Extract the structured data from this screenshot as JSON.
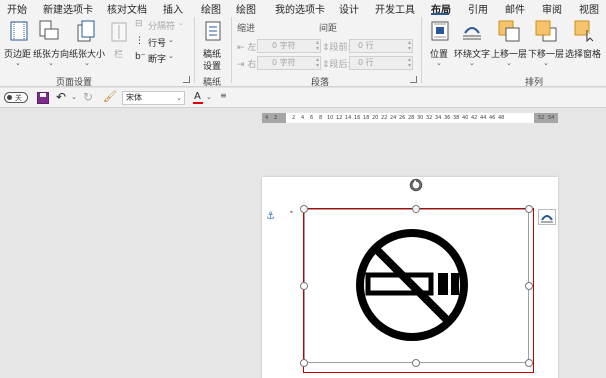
{
  "tabs": [
    "开始",
    "新建选项卡",
    "核对文档",
    "插入",
    "绘图",
    "绘图",
    "我的选项卡",
    "设计",
    "开发工具",
    "布局",
    "引用",
    "邮件",
    "审阅",
    "视图"
  ],
  "active_tab": "布局",
  "page_setup": {
    "margins": "页边距",
    "orientation": "纸张方向",
    "size": "纸张大小",
    "columns": "栏",
    "breaks": "分隔符",
    "line_numbers": "行号",
    "hyphenation": "断字",
    "group_title": "页面设置"
  },
  "draft": {
    "button_line1": "稿纸",
    "button_line2": "设置",
    "group_title": "稿纸"
  },
  "paragraph": {
    "indent_title": "缩进",
    "spacing_title": "间距",
    "left_label": "左:",
    "right_label": "右:",
    "before_label": "段前:",
    "after_label": "段后:",
    "indent_left_value": "0 字符",
    "indent_right_value": "0 字符",
    "spacing_before_value": "0 行",
    "spacing_after_value": "0 行",
    "group_title": "段落"
  },
  "arrange": {
    "position": "位置",
    "wrap_text": "环绕文字",
    "bring_forward": "上移一层",
    "send_backward": "下移一层",
    "selection_pane": "选择窗格",
    "group_title": "排列"
  },
  "qat": {
    "autosave_toggle": "关",
    "font_name": "宋体"
  },
  "ruler_labels": [
    "4",
    "2",
    "2",
    "4",
    "6",
    "8",
    "10",
    "12",
    "14",
    "16",
    "18",
    "20",
    "22",
    "24",
    "26",
    "28",
    "30",
    "32",
    "34",
    "36",
    "38",
    "40",
    "42",
    "44",
    "46",
    "48",
    "52",
    "54"
  ],
  "colors": {
    "accent": "#2b579a",
    "selection_border": "#c00000",
    "font_color_bar": "#e00000",
    "anchor": "#2e75b6"
  }
}
